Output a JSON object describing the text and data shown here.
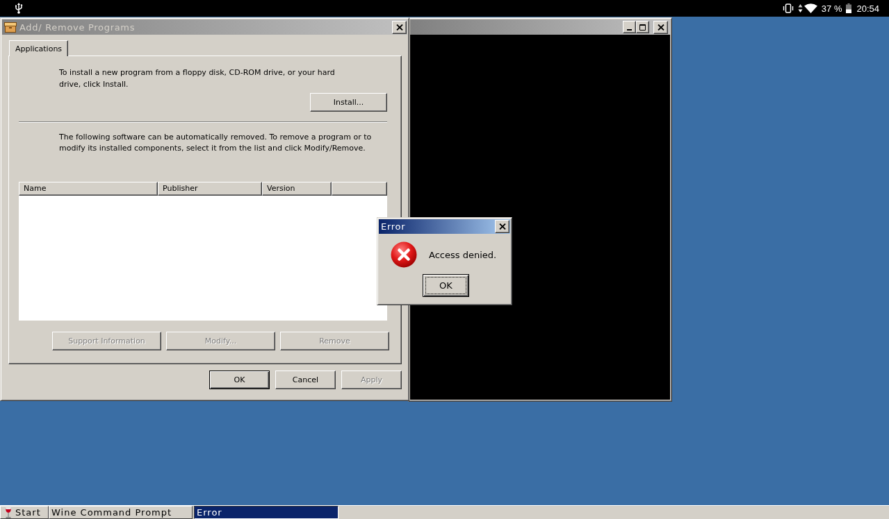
{
  "status_bar": {
    "battery": "37 %",
    "time": "20:54"
  },
  "add_remove_window": {
    "title": "Add/ Remove Programs",
    "active": false,
    "tabs": [
      {
        "label": "Applications",
        "selected": true
      }
    ],
    "install_text": "To install a new program from a floppy disk, CD-ROM drive, or your hard drive, click Install.",
    "install_button": {
      "label": "Install...",
      "disabled": false
    },
    "remove_text": "The following software can be automatically removed. To remove a program or to modify its installed components, select it from the list and click Modify/Remove.",
    "program_list": {
      "columns": [
        "Name",
        "Publisher",
        "Version"
      ]
    },
    "list_buttons": [
      {
        "label": "Support Information",
        "disabled": true
      },
      {
        "label": "Modify...",
        "disabled": true
      },
      {
        "label": "Remove",
        "disabled": true
      }
    ],
    "dialog_buttons": [
      {
        "label": "OK",
        "default": true,
        "disabled": false
      },
      {
        "label": "Cancel",
        "default": false,
        "disabled": false
      },
      {
        "label": "Apply",
        "default": false,
        "disabled": true
      }
    ]
  },
  "console_window": {
    "active": false
  },
  "error_dialog": {
    "title": "Error",
    "active": true,
    "message": "Access denied.",
    "buttons": [
      {
        "label": "OK",
        "default": true,
        "focused": true
      }
    ]
  },
  "taskbar": {
    "start_label": "Start",
    "tasks": [
      {
        "label": "Wine Command Prompt",
        "selected": false
      },
      {
        "label": "Error",
        "selected": true
      }
    ]
  }
}
